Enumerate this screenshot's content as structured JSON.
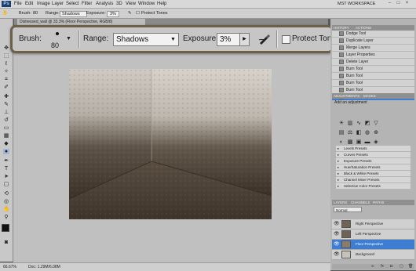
{
  "app": {
    "logo_text": "Ps"
  },
  "menu": [
    "File",
    "Edit",
    "Image",
    "Layer",
    "Select",
    "Filter",
    "Analysis",
    "3D",
    "View",
    "Window",
    "Help"
  ],
  "workspace_label": "MST WORKSPACE",
  "options_small": {
    "brush_label": "Brush:",
    "brush_size": "80",
    "range_label": "Range:",
    "range_value": "Shadows",
    "exposure_label": "Exposure:",
    "exposure_value": "3%",
    "protect_label": "Protect Tones"
  },
  "zoomed_options": {
    "brush_label": "Brush:",
    "brush_size": "80",
    "range_label": "Range:",
    "range_value": "Shadows",
    "exposure_label": "Exposure:",
    "exposure_value": "3%",
    "protect_label": "Protect Tones",
    "protect_checked": false
  },
  "document_tab": "Distressed_wall @ 33.3% (Floor Perspective, RGB/8)",
  "status": {
    "zoom": "66.67%",
    "doc": "Doc: 1.29M/6.08M"
  },
  "history": {
    "tabs": [
      "HISTORY",
      "ACTIONS"
    ],
    "items": [
      "Dodge Tool",
      "Duplicate Layer",
      "Merge Layers",
      "Layer Properties",
      "Delete Layer",
      "Burn Tool",
      "Burn Tool",
      "Burn Tool",
      "Burn Tool",
      "Burn Tool"
    ],
    "selected_index": 9
  },
  "adjustments": {
    "tabs": [
      "ADJUSTMENTS",
      "MASKS"
    ],
    "heading": "Add an adjustment",
    "presets": [
      "Levels Presets",
      "Curves Presets",
      "Exposure Presets",
      "Hue/Saturation Presets",
      "Black & White Presets",
      "Channel Mixer Presets",
      "Selective Color Presets"
    ]
  },
  "layers": {
    "tabs": [
      "LAYERS",
      "CHANNELS",
      "PATHS"
    ],
    "blend_mode": "Normal",
    "items": [
      {
        "name": "Right Perspective",
        "selected": false
      },
      {
        "name": "Left Perspective",
        "selected": false
      },
      {
        "name": "Floor Perspective",
        "selected": true
      },
      {
        "name": "Background",
        "selected": false
      }
    ]
  },
  "colors": {
    "accent": "#3d7ed3",
    "highlight_border": "#6b6048"
  }
}
